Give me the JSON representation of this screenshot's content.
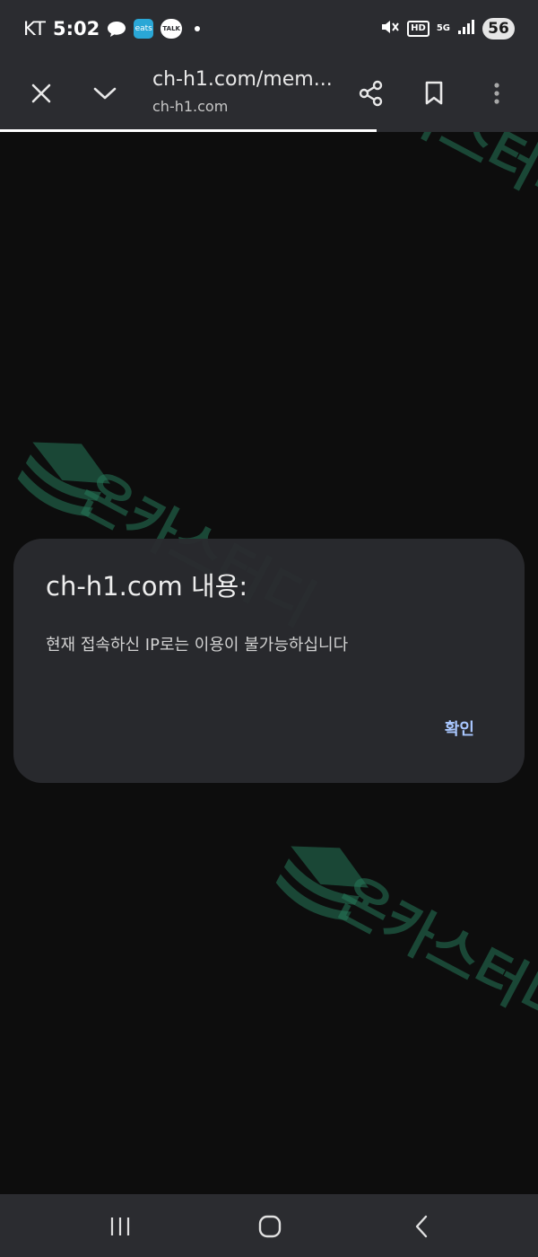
{
  "status_bar": {
    "carrier": "KT",
    "time": "5:02",
    "apps": [
      {
        "name": "chat-bubble-icon"
      },
      {
        "name": "eats-app-icon",
        "label": "eats"
      },
      {
        "name": "kakaotalk-icon",
        "label": "TALK"
      }
    ],
    "hd_label": "HD",
    "network_label": "5G",
    "battery": "56"
  },
  "toolbar": {
    "url_title": "ch-h1.com/mem...",
    "url_domain": "ch-h1.com",
    "page_load_progress": 0.7
  },
  "dialog": {
    "title": "ch-h1.com 내용:",
    "message": "현재 접속하신 IP로는 이용이 불가능하십니다",
    "ok_label": "확인"
  },
  "watermark": {
    "text": "온카스터디"
  },
  "colors": {
    "bar_bg": "#2b2c30",
    "page_bg": "#0d0d0d",
    "dialog_bg": "#2a2b2f",
    "accent": "#a9c7ff",
    "watermark": "#26785a"
  }
}
